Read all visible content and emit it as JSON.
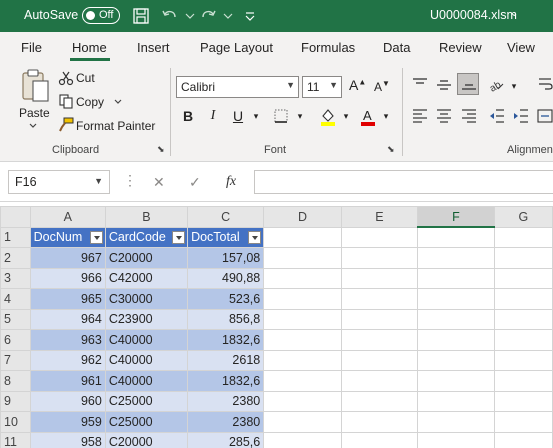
{
  "titlebar": {
    "autosave_label": "AutoSave",
    "autosave_state": "Off",
    "filename": "U0000084.xlsm",
    "filename_chevron": "⌄"
  },
  "tabs": [
    "File",
    "Home",
    "Insert",
    "Page Layout",
    "Formulas",
    "Data",
    "Review",
    "View"
  ],
  "active_tab": "Home",
  "ribbon": {
    "clipboard": {
      "paste_label": "Paste",
      "cut_label": "Cut",
      "copy_label": "Copy",
      "format_painter_label": "Format Painter",
      "group_label": "Clipboard"
    },
    "font": {
      "font_name": "Calibri",
      "font_size": "11",
      "group_label": "Font"
    },
    "alignment": {
      "group_label": "Alignmen"
    }
  },
  "formula_bar": {
    "name_box": "F16",
    "cancel_icon": "✕",
    "enter_icon": "✓",
    "fx_label": "fx",
    "formula": ""
  },
  "grid": {
    "columns": [
      "A",
      "B",
      "C",
      "D",
      "E",
      "F",
      "G"
    ],
    "selected_column": "F",
    "headers": [
      "DocNum",
      "CardCode",
      "DocTotal"
    ],
    "rows": [
      {
        "row": "1"
      },
      {
        "row": "2",
        "doc": "967",
        "card": "C20000",
        "total": "157,08"
      },
      {
        "row": "3",
        "doc": "966",
        "card": "C42000",
        "total": "490,88"
      },
      {
        "row": "4",
        "doc": "965",
        "card": "C30000",
        "total": "523,6"
      },
      {
        "row": "5",
        "doc": "964",
        "card": "C23900",
        "total": "856,8"
      },
      {
        "row": "6",
        "doc": "963",
        "card": "C40000",
        "total": "1832,6"
      },
      {
        "row": "7",
        "doc": "962",
        "card": "C40000",
        "total": "2618"
      },
      {
        "row": "8",
        "doc": "961",
        "card": "C40000",
        "total": "1832,6"
      },
      {
        "row": "9",
        "doc": "960",
        "card": "C25000",
        "total": "2380"
      },
      {
        "row": "10",
        "doc": "959",
        "card": "C25000",
        "total": "2380"
      },
      {
        "row": "11",
        "doc": "958",
        "card": "C20000",
        "total": "285,6"
      }
    ]
  },
  "colors": {
    "brand": "#217346",
    "table_header": "#4472c4",
    "band_dark": "#b4c6e7",
    "band_light": "#d9e1f2"
  }
}
